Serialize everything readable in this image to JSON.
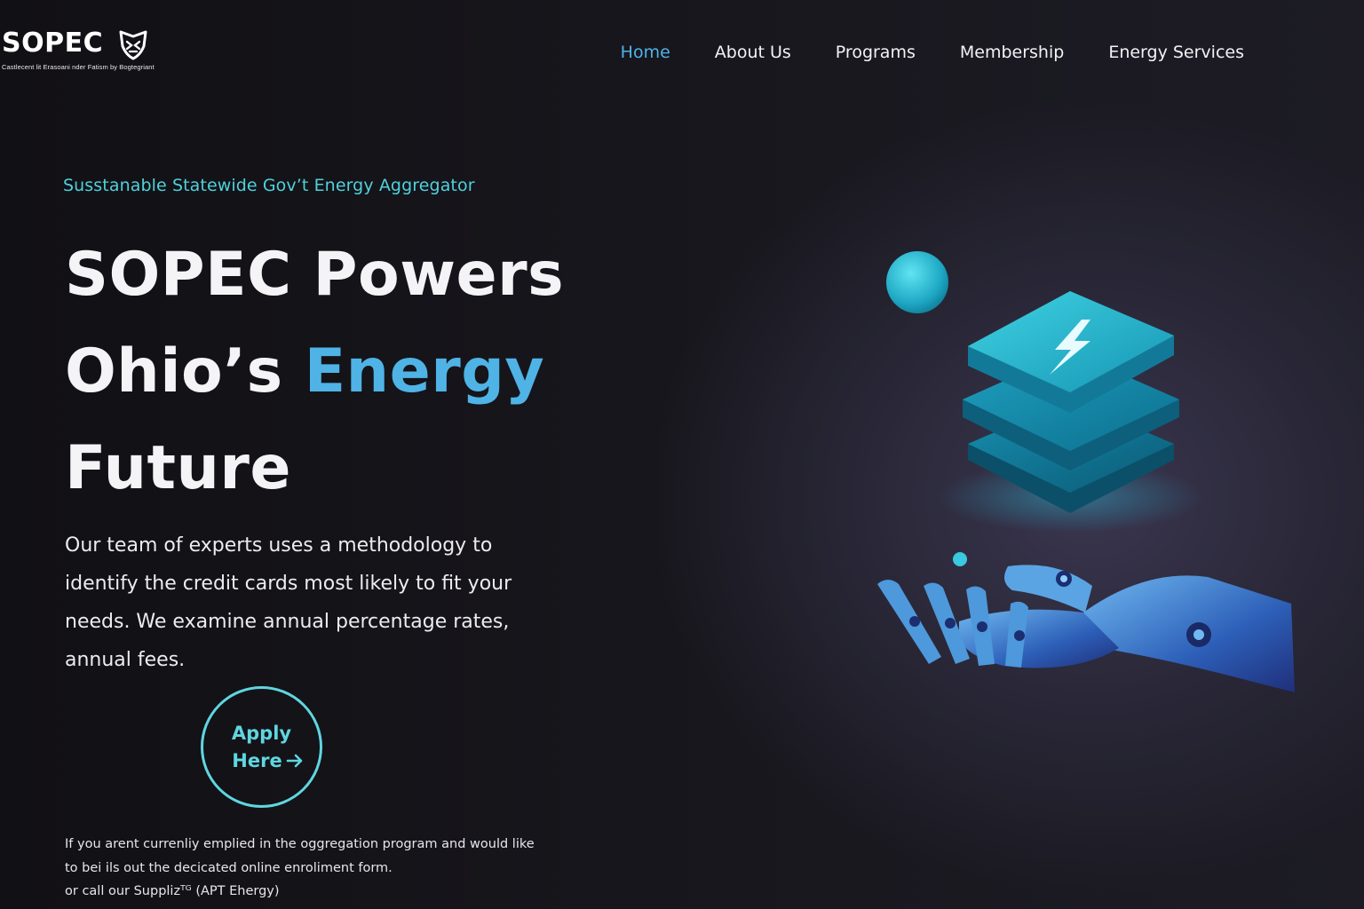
{
  "brand": {
    "name": "SOPEC",
    "tagline": "Castlecent lit Erasoani nder Fatism by Bogtegriant",
    "logo_icon": "shield-icon"
  },
  "nav": {
    "items": [
      {
        "label": "Home",
        "active": true
      },
      {
        "label": "About Us",
        "active": false
      },
      {
        "label": "Programs",
        "active": false
      },
      {
        "label": "Membership",
        "active": false
      },
      {
        "label": "Energy Services",
        "active": false
      }
    ]
  },
  "hero": {
    "eyebrow": "Susstanable Statewide Gov’t Energy Aggregator",
    "title_line1": "SOPEC Powers",
    "title_line2_a": "Ohio’s ",
    "title_line2_b": "Energy",
    "title_line3": "Future",
    "description": "Our team of experts uses a methodology to identify the credit cards most likely to fit your needs. We examine annual percentage rates, annual fees.",
    "cta_line1": "Apply",
    "cta_line2": "Here",
    "cta_icon": "arrow-right-icon",
    "footnote_line1": "If you arent currenliy emplied in the oggregation program and would like",
    "footnote_line2": "to bei ils out the decicated online enroliment form.",
    "footnote_line3": "or call our Supplizᵀᴳ (APT Ehergy)"
  },
  "illustration": {
    "icons": [
      "lightning-bolt-icon",
      "robotic-hand-icon",
      "sphere-icon"
    ]
  },
  "colors": {
    "accent": "#4fb3e6",
    "teal": "#4fd1dc",
    "background": "#141318"
  }
}
